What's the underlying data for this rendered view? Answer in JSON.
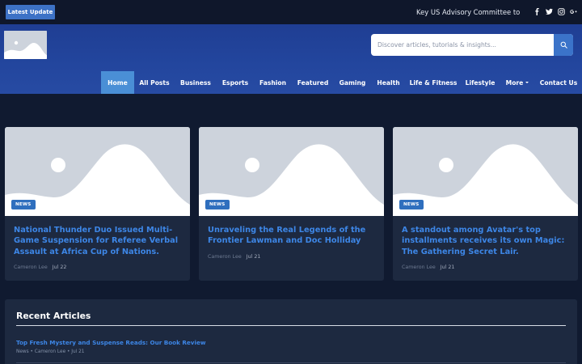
{
  "topbar": {
    "latest_label": "Latest Update",
    "ticker_text": "Key US Advisory Committee to Cast Its Vote",
    "social": [
      "facebook-icon",
      "twitter-icon",
      "instagram-icon",
      "google-plus-icon"
    ]
  },
  "header": {
    "search_placeholder": "Discover articles, tutorials & insights...",
    "nav": [
      {
        "label": "Home",
        "active": true
      },
      {
        "label": "All Posts"
      },
      {
        "label": "Business"
      },
      {
        "label": "Esports"
      },
      {
        "label": "Fashion"
      },
      {
        "label": "Featured"
      },
      {
        "label": "Gaming"
      },
      {
        "label": "Health"
      },
      {
        "label": "Life & Fitness"
      },
      {
        "label": "Lifestyle"
      },
      {
        "label": "More"
      },
      {
        "label": "Contact Us"
      }
    ]
  },
  "cards": [
    {
      "badge": "NEWS",
      "title": "National Thunder Duo Issued Multi-Game Suspension for Referee Verbal Assault at Africa Cup of Nations.",
      "author": "Cameron Lee",
      "date": "Jul 22"
    },
    {
      "badge": "NEWS",
      "title": "Unraveling the Real Legends of the Frontier Lawman and Doc Holliday",
      "author": "Cameron Lee",
      "date": "Jul 21"
    },
    {
      "badge": "NEWS",
      "title": "A standout among Avatar's top installments receives its own Magic: The Gathering Secret Lair.",
      "author": "Cameron Lee",
      "date": "Jul 21"
    }
  ],
  "recent": {
    "title": "Recent Articles",
    "items": [
      {
        "title": "Top Fresh Mystery and Suspense Reads: Our Book Review",
        "meta": "News • Cameron Lee • Jul 21"
      }
    ]
  },
  "colors": {
    "accent": "#3d86e6",
    "header_blue": "#23469e",
    "nav_active": "#4a8fd6",
    "page_bg": "#101a30",
    "card_bg": "#1d2940"
  }
}
